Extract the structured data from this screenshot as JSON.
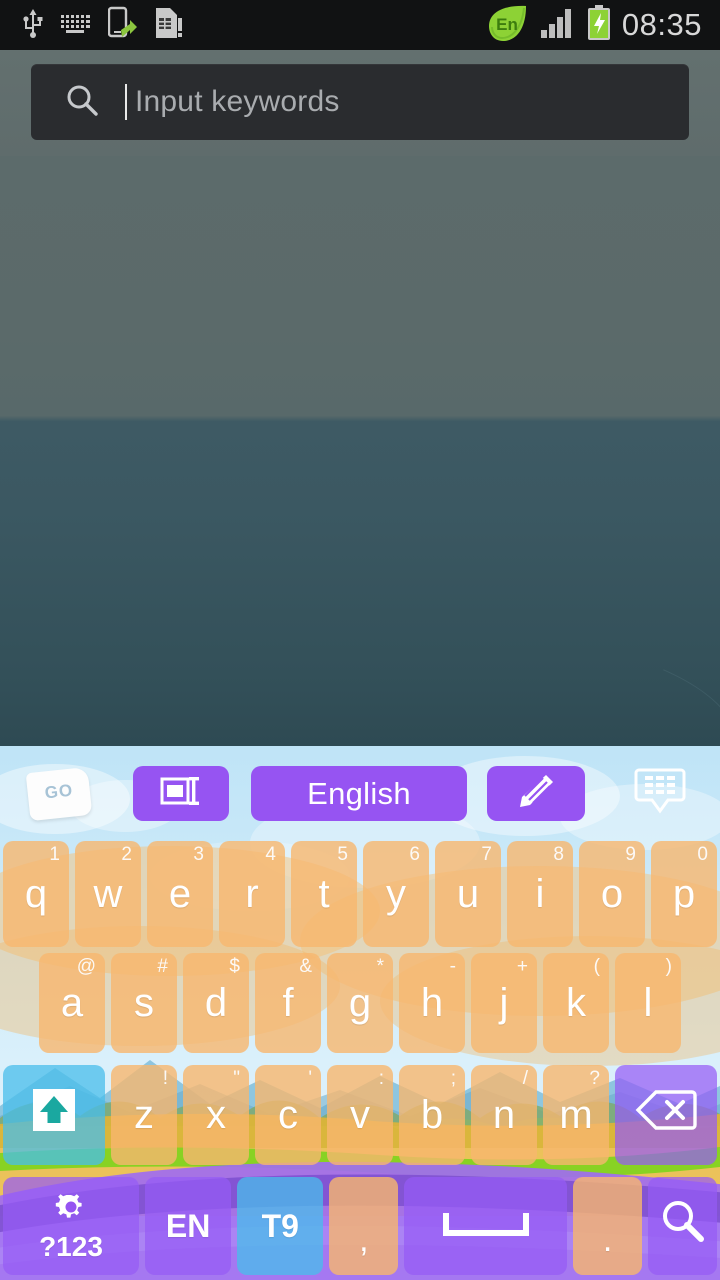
{
  "status_bar": {
    "icons_left": [
      "usb-icon",
      "keyboard-icon",
      "usb-debug-transfer-icon",
      "sim-card-alert-icon"
    ],
    "icons_right": [
      "input-language-en-icon",
      "signal-bars-icon",
      "battery-charging-icon"
    ],
    "language_badge": "En",
    "clock": "08:35",
    "background_color": "#111213",
    "text_color": "#d8d8d8"
  },
  "search": {
    "icon": "search-icon",
    "placeholder": "Input keywords",
    "value": "",
    "caret_visible": true,
    "field_background": "#2a2c2f",
    "bar_background": "#63706f"
  },
  "wallpaper": {
    "description": "calm teal water and sky gradient",
    "sky_color": "#5c6b6b",
    "water_color": "#3b5862"
  },
  "keyboard": {
    "theme_name": "landscape-theme",
    "accent_color": "#9654f2",
    "key_color": "#f7b76e",
    "toolbar": {
      "logo": {
        "name": "go-keyboard-logo",
        "text": "GO"
      },
      "buttons": [
        {
          "name": "resize-layout-button",
          "icon": "layout-resize-icon",
          "label": ""
        },
        {
          "name": "language-button",
          "icon": "",
          "label": "English"
        },
        {
          "name": "edit-pen-button",
          "icon": "pen-edit-icon",
          "label": ""
        }
      ],
      "hide_keyboard": {
        "name": "hide-keyboard-button",
        "icon": "keyboard-hide-icon"
      }
    },
    "row1": [
      {
        "key": "q",
        "hint": "1"
      },
      {
        "key": "w",
        "hint": "2"
      },
      {
        "key": "e",
        "hint": "3"
      },
      {
        "key": "r",
        "hint": "4"
      },
      {
        "key": "t",
        "hint": "5"
      },
      {
        "key": "y",
        "hint": "6"
      },
      {
        "key": "u",
        "hint": "7"
      },
      {
        "key": "i",
        "hint": "8"
      },
      {
        "key": "o",
        "hint": "9"
      },
      {
        "key": "p",
        "hint": "0"
      }
    ],
    "row2": [
      {
        "key": "a",
        "hint": "@"
      },
      {
        "key": "s",
        "hint": "#"
      },
      {
        "key": "d",
        "hint": "$"
      },
      {
        "key": "f",
        "hint": "&"
      },
      {
        "key": "g",
        "hint": "*"
      },
      {
        "key": "h",
        "hint": "-"
      },
      {
        "key": "j",
        "hint": "+"
      },
      {
        "key": "k",
        "hint": "("
      },
      {
        "key": "l",
        "hint": ")"
      }
    ],
    "row3": {
      "shift": {
        "name": "shift-key",
        "icon": "shift-arrow-up-icon"
      },
      "keys": [
        {
          "key": "z",
          "hint": "!"
        },
        {
          "key": "x",
          "hint": "\""
        },
        {
          "key": "c",
          "hint": "'"
        },
        {
          "key": "v",
          "hint": ":"
        },
        {
          "key": "b",
          "hint": ";"
        },
        {
          "key": "n",
          "hint": "/"
        },
        {
          "key": "m",
          "hint": "?"
        }
      ],
      "backspace": {
        "name": "backspace-key",
        "icon": "backspace-delete-icon"
      }
    },
    "row4": [
      {
        "name": "symbols-key",
        "label": "?123",
        "icon": "gear-icon",
        "style": "purple"
      },
      {
        "name": "language-switch-key",
        "label": "EN",
        "icon": "",
        "style": "purple"
      },
      {
        "name": "t9-key",
        "label": "T9",
        "icon": "",
        "style": "cyan"
      },
      {
        "name": "comma-key",
        "label": ",",
        "icon": "",
        "style": "letter"
      },
      {
        "name": "space-key",
        "label": "",
        "icon": "space-bar-icon",
        "style": "purple"
      },
      {
        "name": "period-key",
        "label": ".",
        "icon": "",
        "style": "letter"
      },
      {
        "name": "search-enter-key",
        "label": "",
        "icon": "search-icon",
        "style": "purple"
      }
    ]
  }
}
